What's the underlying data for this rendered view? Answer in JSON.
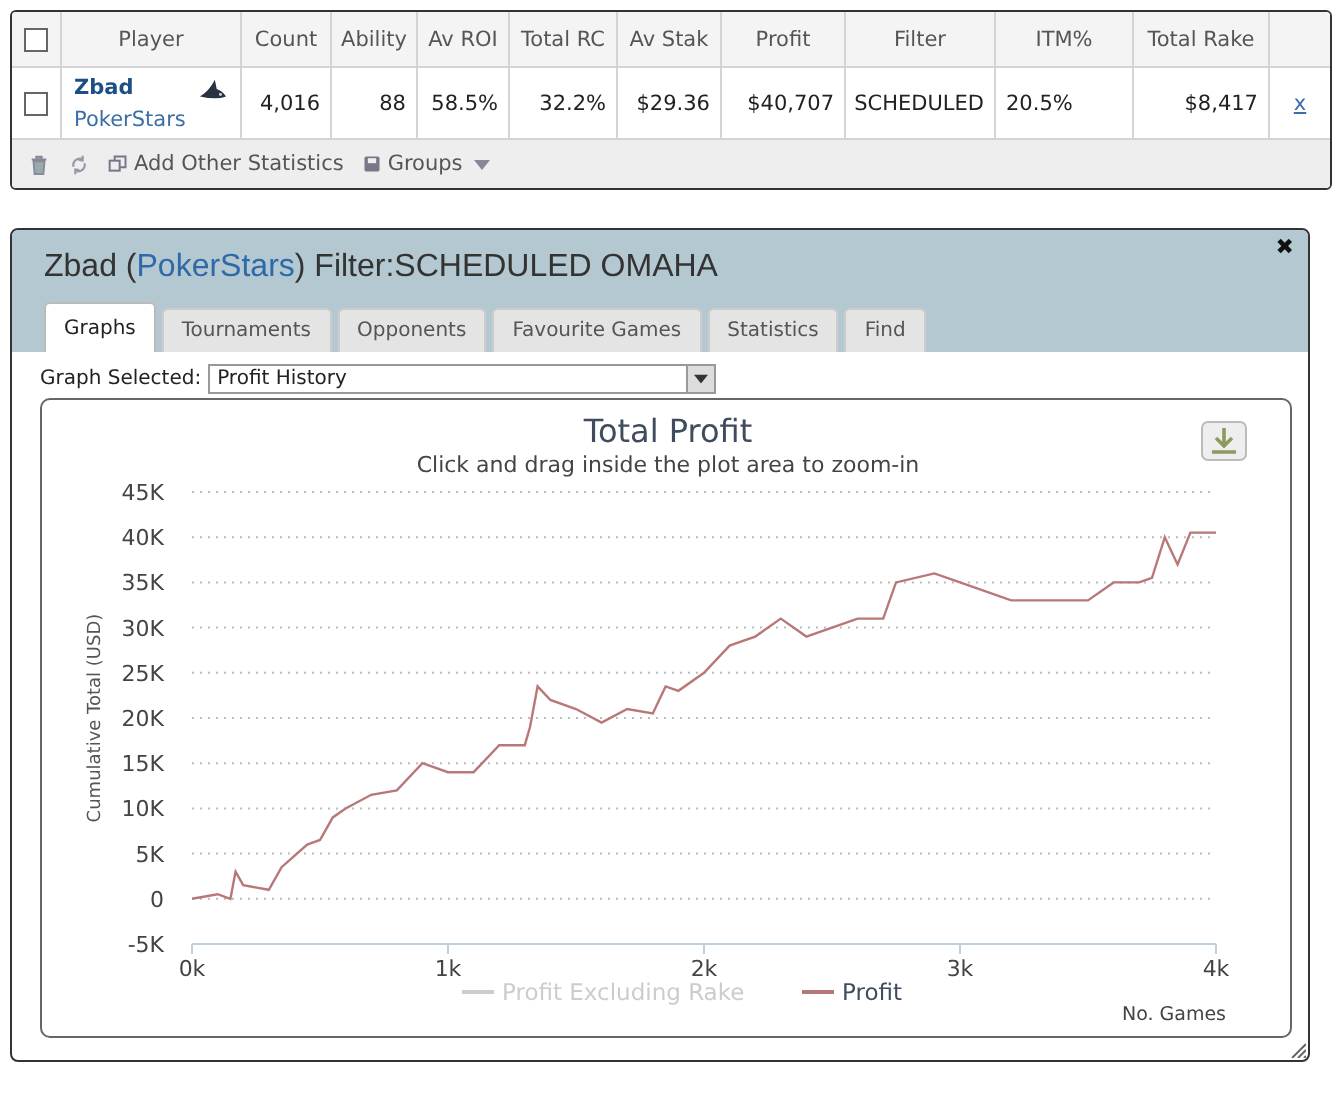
{
  "stats_table": {
    "player_column": "Player",
    "columns": [
      "Count",
      "Ability",
      "Av ROI",
      "Total RC",
      "Av Stak",
      "Profit",
      "Filter",
      "ITM%",
      "Total Rake"
    ],
    "header_checked": false,
    "rows": [
      {
        "checked": false,
        "player": "Zbad",
        "site": "PokerStars",
        "cells": [
          "4,016",
          "88",
          "58.5%",
          "32.2%",
          "$29.36",
          "$40,707",
          "SCHEDULED",
          "20.5%",
          "$8,417"
        ],
        "remove": "x"
      }
    ],
    "footer": {
      "add_label": "Add Other Statistics",
      "groups_label": "Groups"
    }
  },
  "dialog": {
    "title": [
      {
        "kind": "plain",
        "text": "Zbad ("
      },
      {
        "kind": "link",
        "text": "PokerStars"
      },
      {
        "kind": "plain",
        "text": ") Filter:SCHEDULED OMAHA"
      }
    ],
    "close": "✖",
    "tabs": [
      {
        "label": "Graphs",
        "selected": true
      },
      {
        "label": "Tournaments",
        "selected": false
      },
      {
        "label": "Opponents",
        "selected": false
      },
      {
        "label": "Favourite Games",
        "selected": false
      },
      {
        "label": "Statistics",
        "selected": false
      },
      {
        "label": "Find",
        "selected": false
      }
    ],
    "graph_select": {
      "label": "Graph Selected:",
      "value": "Profit History"
    },
    "legend": [
      {
        "label": "Profit Excluding Rake",
        "enabled": false
      }
    ],
    "chart_data": {
      "type": "line",
      "grid": true,
      "title": "Total Profit",
      "subtitle": "Click and drag inside the plot area to zoom-in",
      "xlabel": "No. Games",
      "ylabel": "Cumulative Total (USD)",
      "x": [
        0,
        100,
        150,
        170,
        200,
        300,
        350,
        450,
        500,
        550,
        600,
        700,
        800,
        900,
        1000,
        1100,
        1200,
        1300,
        1320,
        1350,
        1400,
        1500,
        1600,
        1700,
        1800,
        1850,
        1900,
        2000,
        2100,
        2200,
        2300,
        2400,
        2500,
        2600,
        2700,
        2750,
        2900,
        3000,
        3200,
        3300,
        3400,
        3500,
        3600,
        3700,
        3750,
        3800,
        3850,
        3900,
        4000
      ],
      "series": [
        {
          "name": "Profit",
          "color": "#b87878",
          "values": [
            0,
            500,
            0,
            3000,
            1500,
            1000,
            3500,
            6000,
            6500,
            9000,
            10000,
            11500,
            12000,
            15000,
            14000,
            14000,
            17000,
            17000,
            19000,
            23500,
            22000,
            21000,
            19500,
            21000,
            20500,
            23500,
            23000,
            25000,
            28000,
            29000,
            31000,
            29000,
            30000,
            31000,
            31000,
            35000,
            36000,
            35000,
            33000,
            33000,
            33000,
            33000,
            35000,
            35000,
            35500,
            40000,
            37000,
            40500,
            40500
          ]
        }
      ],
      "xlim": [
        0,
        4000
      ],
      "ylim": [
        -5000,
        45000
      ],
      "xticks": [
        {
          "value": 0,
          "label": "0k"
        },
        {
          "value": 1000,
          "label": "1k"
        },
        {
          "value": 2000,
          "label": "2k"
        },
        {
          "value": 3000,
          "label": "3k"
        },
        {
          "value": 4000,
          "label": "4k"
        }
      ],
      "yticks": [
        {
          "value": -5000,
          "label": "-5K"
        },
        {
          "value": 0,
          "label": "0"
        },
        {
          "value": 5000,
          "label": "5K"
        },
        {
          "value": 10000,
          "label": "10K"
        },
        {
          "value": 15000,
          "label": "15K"
        },
        {
          "value": 20000,
          "label": "20K"
        },
        {
          "value": 25000,
          "label": "25K"
        },
        {
          "value": 30000,
          "label": "30K"
        },
        {
          "value": 35000,
          "label": "35K"
        },
        {
          "value": 40000,
          "label": "40K"
        },
        {
          "value": 45000,
          "label": "45K"
        }
      ]
    }
  }
}
